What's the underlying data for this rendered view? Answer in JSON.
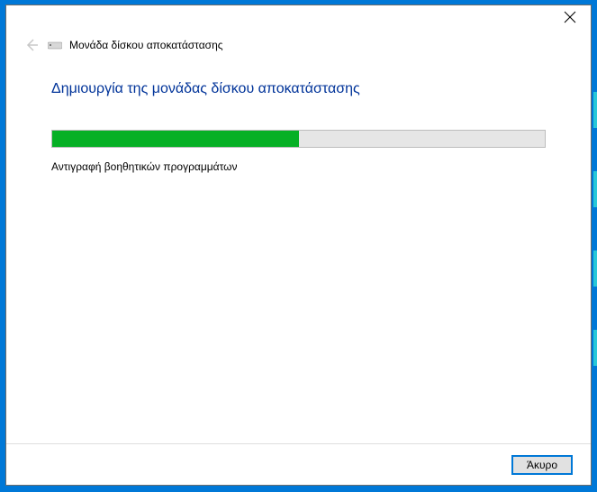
{
  "window": {
    "title": "Μονάδα δίσκου αποκατάστασης"
  },
  "content": {
    "heading": "Δημιουργία της μονάδας δίσκου αποκατάστασης",
    "progress_percent": 50,
    "status_text": "Αντιγραφή βοηθητικών προγραμμάτων"
  },
  "footer": {
    "cancel_label": "Άκυρο"
  }
}
